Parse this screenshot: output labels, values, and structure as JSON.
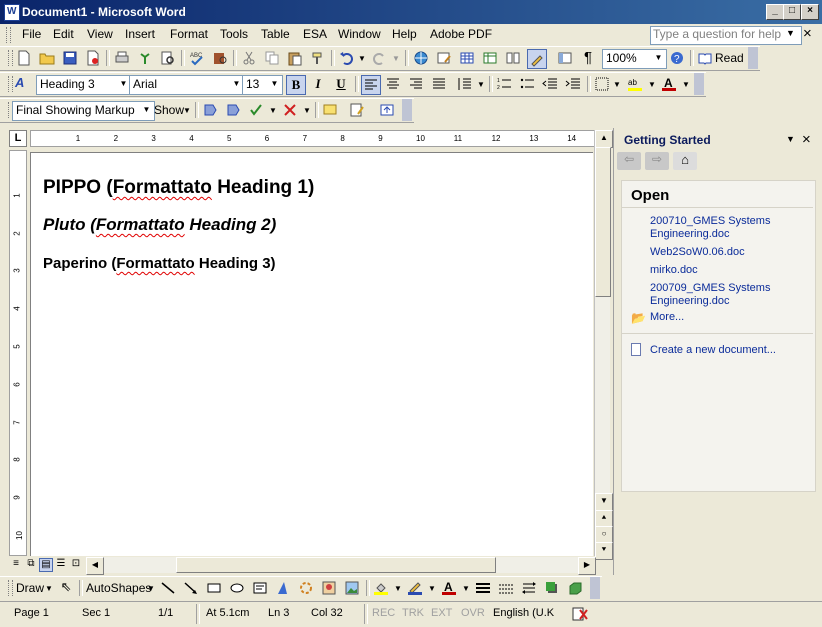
{
  "window": {
    "title": "Document1 - Microsoft Word",
    "min": "_",
    "max": "□",
    "close": "×"
  },
  "menu": {
    "items": [
      "File",
      "Edit",
      "View",
      "Insert",
      "Format",
      "Tools",
      "Table",
      "ESA",
      "Window",
      "Help",
      "Adobe PDF"
    ],
    "help_placeholder": "Type a question for help",
    "close": "×"
  },
  "standard_toolbar": {
    "zoom": "100%",
    "read_label": "Read"
  },
  "formatting_toolbar": {
    "style": "Heading 3",
    "font": "Arial",
    "size": "13",
    "bold": "B",
    "italic": "I",
    "underline": "U"
  },
  "reviewing_toolbar": {
    "display": "Final Showing Markup",
    "show_label": "Show"
  },
  "ruler": {
    "h_ticks": [
      "1",
      "2",
      "3",
      "4",
      "5",
      "6",
      "7",
      "8",
      "9",
      "10",
      "11",
      "12",
      "13",
      "14"
    ],
    "v_ticks": [
      "1",
      "2",
      "3",
      "4",
      "5",
      "6",
      "7",
      "8",
      "9",
      "10"
    ]
  },
  "document": {
    "h1": {
      "a": "PIPPO (",
      "b": "Formattato",
      "c": " Heading 1)"
    },
    "h2": {
      "a": "Pluto (",
      "b": "Formattato",
      "c": " Heading 2)"
    },
    "h3": {
      "a": "Paperino (",
      "b": "Formattato",
      "c": " Heading 3)"
    }
  },
  "task_pane": {
    "title": "Getting Started",
    "section": "Open",
    "files": [
      "200710_GMES Systems\nEngineering.doc",
      "Web2SoW0.06.doc",
      "mirko.doc",
      "200709_GMES Systems\nEngineering.doc"
    ],
    "more": "More...",
    "create": "Create a new document..."
  },
  "drawing_toolbar": {
    "draw": "Draw",
    "autoshapes": "AutoShapes"
  },
  "status": {
    "page": "Page  1",
    "sec": "Sec  1",
    "pages": "1/1",
    "at": "At  5.1cm",
    "ln": "Ln  3",
    "col": "Col  32",
    "rec": "REC",
    "trk": "TRK",
    "ext": "EXT",
    "ovr": "OVR",
    "lang": "English (U.K"
  },
  "colors": {
    "accent": "#0a246a",
    "link": "#0b2c9a",
    "squiggle": "#e00000"
  }
}
